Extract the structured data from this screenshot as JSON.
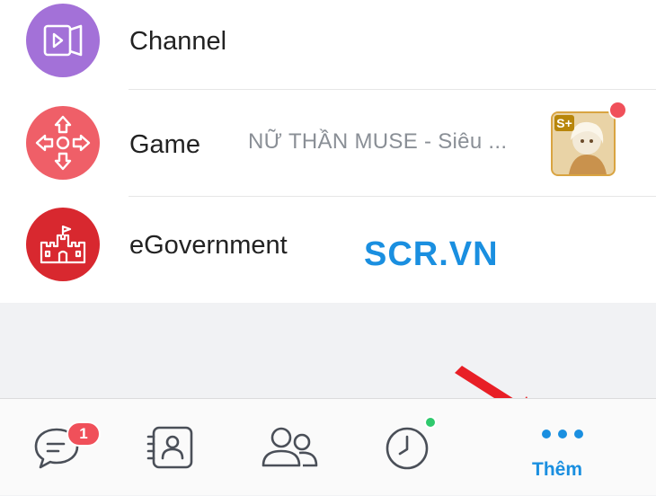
{
  "list": {
    "items": [
      {
        "label": "Channel",
        "icon": "channel-play-icon",
        "color": "#a371d8"
      },
      {
        "label": "Game",
        "icon": "dpad-icon",
        "color": "#ef5f68",
        "subtitle": "NỮ THẦN MUSE - Siêu ...",
        "thumb_text": "S+"
      },
      {
        "label": "eGovernment",
        "icon": "castle-icon",
        "color": "#d8282f"
      }
    ]
  },
  "watermark": "SCR.VN",
  "tabbar": {
    "messages_badge": "1",
    "more_label": "Thêm",
    "accent": "#1a8fe0"
  }
}
